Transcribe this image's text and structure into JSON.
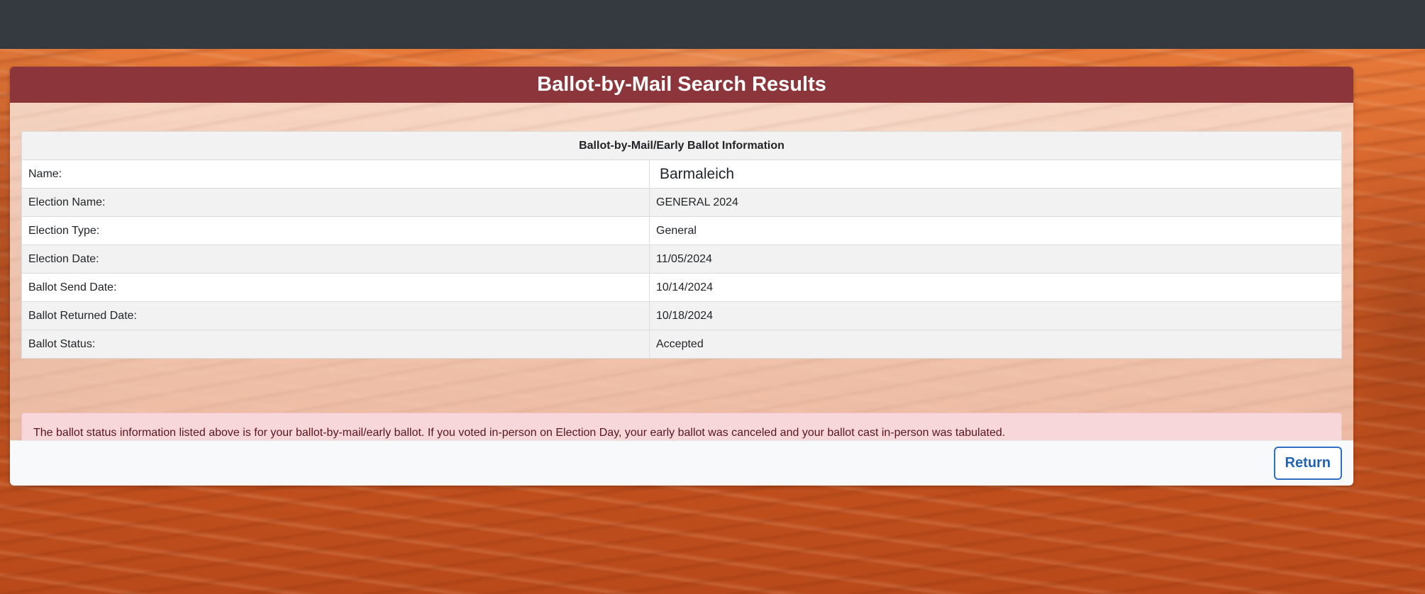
{
  "header": {
    "title": "Ballot-by-Mail Search Results"
  },
  "table": {
    "heading": "Ballot-by-Mail/Early Ballot Information",
    "rows": [
      {
        "label": "Name:",
        "value": "Barmaleich"
      },
      {
        "label": "Election Name:",
        "value": "GENERAL 2024"
      },
      {
        "label": "Election Type:",
        "value": "General"
      },
      {
        "label": "Election Date:",
        "value": "11/05/2024"
      },
      {
        "label": "Ballot Send Date:",
        "value": "10/14/2024"
      },
      {
        "label": "Ballot Returned Date:",
        "value": "10/18/2024"
      },
      {
        "label": "Ballot Status:",
        "value": "Accepted"
      }
    ]
  },
  "alert": {
    "text": "The ballot status information listed above is for your ballot-by-mail/early ballot. If you voted in-person on Election Day, your early ballot was canceled and your ballot cast in-person was tabulated."
  },
  "footer": {
    "return_label": "Return"
  },
  "colors": {
    "topbar": "#343a40",
    "header": "#8c353b",
    "alert_bg": "#f8d7da",
    "button_accent": "#2f6fc3"
  }
}
